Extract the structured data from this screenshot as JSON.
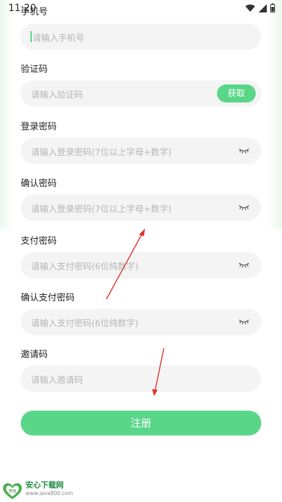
{
  "status_bar": {
    "time": "11:20"
  },
  "form": {
    "phone": {
      "label": "手机号",
      "placeholder": "请输入手机号"
    },
    "verification_code": {
      "label": "验证码",
      "placeholder": "请输入验证码",
      "button": "获取"
    },
    "login_password": {
      "label": "登录密码",
      "placeholder": "请输入登录密码(7位以上字母+数字)"
    },
    "confirm_password": {
      "label": "确认密码",
      "placeholder": "请输入登录密码(7位以上字母+数字)"
    },
    "pay_password": {
      "label": "支付密码",
      "placeholder": "请输入支付密码(6位纯数字)"
    },
    "confirm_pay_password": {
      "label": "确认支付密码",
      "placeholder": "请输入支付密码(6位纯数字)"
    },
    "invite_code": {
      "label": "邀请码",
      "placeholder": "请输入邀请码"
    },
    "submit": "注册"
  },
  "watermark": {
    "title": "安心下载网",
    "url": "www.java800.com",
    "logo_text": "常信"
  },
  "colors": {
    "accent": "#5ad689",
    "arrow": "#e0302a",
    "field_bg": "#f4f4f4"
  },
  "icons": [
    "wifi-icon",
    "signal-icon",
    "battery-icon",
    "eye-closed-icon"
  ]
}
